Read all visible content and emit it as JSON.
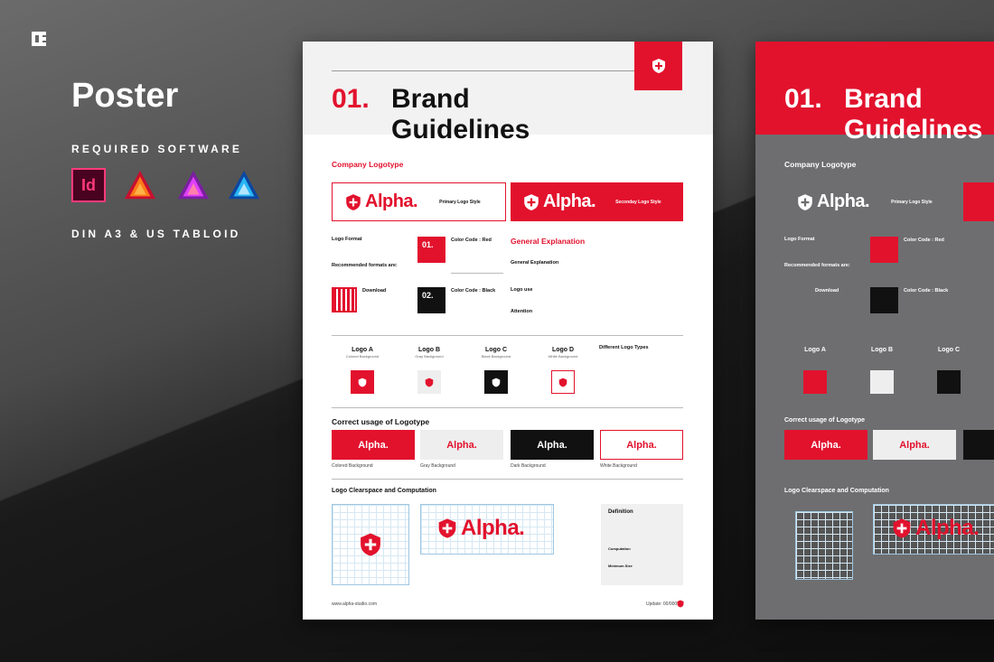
{
  "left": {
    "title": "Poster",
    "required": "REQUIRED SOFTWARE",
    "formats": "DIN A3 & US TABLOID",
    "software_icons": [
      "indesign-icon",
      "affinity-publisher-icon",
      "affinity-photo-icon",
      "affinity-designer-icon"
    ],
    "indesign_label": "Id"
  },
  "poster": {
    "number": "01.",
    "title_line1": "Brand",
    "title_line2": "Guidelines",
    "company_logotype": "Company Logotype",
    "brand": "Alpha.",
    "primary_style": "Primary Logo Style",
    "secondary_style": "Seconday Logo Style",
    "logo_format": "Logo Format",
    "recommended": "Recommended formats are:",
    "download": "Download",
    "color_red": "Color Code : Red",
    "color_black": "Color Code : Black",
    "c01": "01.",
    "c02": "02.",
    "general_explanation_title": "General Explanation",
    "general_explanation": "General Explanation",
    "logo_use": "Logo use",
    "attention": "Attention",
    "logo_a": "Logo A",
    "logo_a_sub": "Colored Background",
    "logo_b": "Logo B",
    "logo_b_sub": "Gray Background",
    "logo_c": "Logo C",
    "logo_c_sub": "Black Background",
    "logo_d": "Logo D",
    "logo_d_sub": "White Background",
    "different_types": "Different Logo Types",
    "correct_usage": "Correct usage of Logotype",
    "usage_labels": [
      "Colored Background",
      "Gray Background",
      "Dark Background",
      "White Background"
    ],
    "clearspace": "Logo Clearspace and Computation",
    "definition": "Definition",
    "computation": "Computation",
    "minimum_size": "Minimum Size",
    "footer_url": "www.alpha-studio.com",
    "footer_update": "Update: 00/0000"
  },
  "colors": {
    "accent": "#e2122d",
    "dark": "#111111",
    "grey_poster": "#6e6e70"
  }
}
